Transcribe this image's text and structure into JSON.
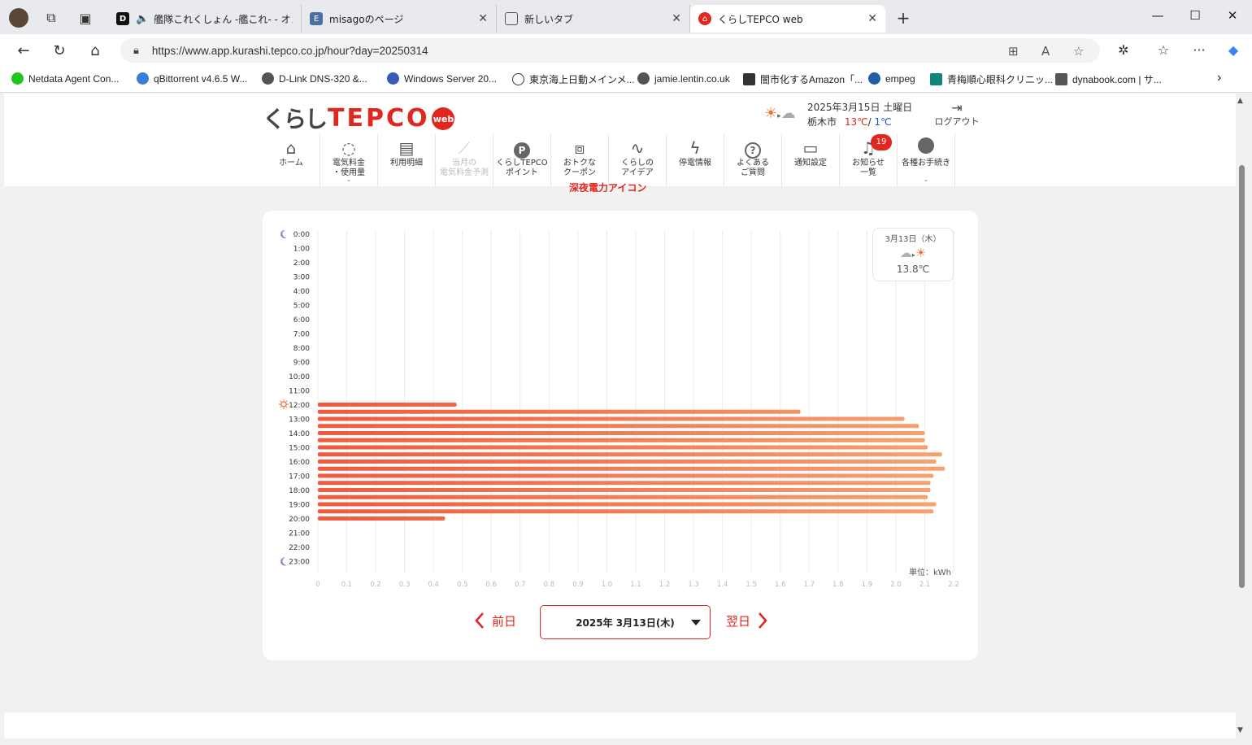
{
  "browser": {
    "tabs": [
      {
        "title": "艦隊これくしょん -艦これ- - オン",
        "favicon_color": "#111111",
        "favicon_text": "D",
        "active": false
      },
      {
        "title": "misagoのページ",
        "favicon_color": "#4a6fa5",
        "favicon_text": "E",
        "active": false
      },
      {
        "title": "新しいタブ",
        "favicon_color": "#ffffff",
        "favicon_text": "",
        "active": false
      },
      {
        "title": "くらしTEPCO web",
        "favicon_color": "#e0261d",
        "favicon_text": "⌂",
        "active": true
      }
    ],
    "url": "https://www.app.kurashi.tepco.co.jp/hour?day=20250314",
    "bookmarks": [
      {
        "label": "Netdata Agent Con...",
        "color": "#1ec61e"
      },
      {
        "label": "qBittorrent v4.6.5 W...",
        "color": "#3b7dd8"
      },
      {
        "label": "D-Link DNS-320 &...",
        "color": "#555555"
      },
      {
        "label": "Windows Server 20...",
        "color": "#3a58b8"
      },
      {
        "label": "東京海上日動メインメ...",
        "color": "#777777"
      },
      {
        "label": "jamie.lentin.co.uk",
        "color": "#555555"
      },
      {
        "label": "闇市化するAmazon「...",
        "color": "#333333"
      },
      {
        "label": "empeg",
        "color": "#1f5fa8"
      },
      {
        "label": "青梅順心眼科クリニッ...",
        "color": "#10857a"
      },
      {
        "label": "dynabook.com | サ...",
        "color": "#555555"
      }
    ]
  },
  "header": {
    "logo_kurashi": "くらし",
    "logo_text": "TEPCO",
    "logo_badge": "web",
    "weather_date": "2025年3月15日 土曜日",
    "city": "栃木市",
    "temp_high": "13℃",
    "temp_sep": "/",
    "temp_low": "1℃",
    "logout": "ログアウト"
  },
  "nav": [
    {
      "line1": "ホーム",
      "line2": "",
      "icon": "home-icon",
      "glyph": "⌂",
      "disabled": false,
      "chevron": false
    },
    {
      "line1": "電気料金",
      "line2": "・使用量",
      "icon": "lightbulb-icon",
      "glyph": "◌",
      "disabled": false,
      "chevron": true
    },
    {
      "line1": "利用明細",
      "line2": "",
      "icon": "document-icon",
      "glyph": "▤",
      "disabled": false,
      "chevron": false
    },
    {
      "line1": "当月の",
      "line2": "電気料金予測",
      "icon": "trend-icon",
      "glyph": "⟋",
      "disabled": true,
      "chevron": false
    },
    {
      "line1": "くらしTEPCO",
      "line2": "ポイント",
      "icon": "point-icon",
      "glyph": "P",
      "disabled": false,
      "chevron": false
    },
    {
      "line1": "おトクな",
      "line2": "クーポン",
      "icon": "gift-icon",
      "glyph": "⧈",
      "disabled": false,
      "chevron": false
    },
    {
      "line1": "くらしの",
      "line2": "アイデア",
      "icon": "idea-icon",
      "glyph": "∿",
      "disabled": false,
      "chevron": false
    },
    {
      "line1": "停電情報",
      "line2": "",
      "icon": "lightning-icon",
      "glyph": "ϟ",
      "disabled": false,
      "chevron": false
    },
    {
      "line1": "よくある",
      "line2": "ご質問",
      "icon": "question-icon",
      "glyph": "?",
      "disabled": false,
      "chevron": false
    },
    {
      "line1": "通知設定",
      "line2": "",
      "icon": "chat-icon",
      "glyph": "▭",
      "disabled": false,
      "chevron": false
    },
    {
      "line1": "お知らせ",
      "line2": "一覧",
      "icon": "bell-icon",
      "glyph": "♫",
      "disabled": false,
      "chevron": false,
      "badge": "19"
    },
    {
      "line1": "各種お手続き",
      "line2": "",
      "icon": "user-icon",
      "glyph": "●",
      "disabled": false,
      "chevron": true
    }
  ],
  "partial_heading": "深夜電力アイコン",
  "weather_box": {
    "date": "3月13日（木）",
    "temp": "13.8℃"
  },
  "unit_label": "単位：kWh",
  "day_nav": {
    "prev": "前日",
    "selected_date": "2025年 3月13日(木)",
    "next": "翌日"
  },
  "chart_data": {
    "type": "bar",
    "orientation": "horizontal",
    "categories": [
      "0:00",
      "1:00",
      "2:00",
      "3:00",
      "4:00",
      "5:00",
      "6:00",
      "7:00",
      "8:00",
      "9:00",
      "10:00",
      "11:00",
      "12:00",
      "13:00",
      "14:00",
      "15:00",
      "16:00",
      "17:00",
      "18:00",
      "19:00",
      "20:00",
      "21:00",
      "22:00",
      "23:00"
    ],
    "x_ticks": [
      "0",
      "0.1",
      "0.2",
      "0.3",
      "0.4",
      "0.5",
      "0.6",
      "0.7",
      "0.8",
      "0.9",
      "1.0",
      "1.1",
      "1.2",
      "1.3",
      "1.4",
      "1.5",
      "1.6",
      "1.7",
      "1.8",
      "1.9",
      "2.0",
      "2.1",
      "2.2"
    ],
    "xlim": [
      0,
      2.2
    ],
    "grid": true,
    "legend": "none",
    "colors": {
      "bar_start": "#ef5a3c",
      "bar_end": "#f6a470",
      "moon": "#8b7fe0",
      "sun": "#f07030"
    },
    "half_hour_bars": [
      {
        "hour": 12,
        "half": 0,
        "value": 0.48
      },
      {
        "hour": 12,
        "half": 1,
        "value": 1.67
      },
      {
        "hour": 13,
        "half": 0,
        "value": 2.03
      },
      {
        "hour": 13,
        "half": 1,
        "value": 2.08
      },
      {
        "hour": 14,
        "half": 0,
        "value": 2.1
      },
      {
        "hour": 14,
        "half": 1,
        "value": 2.1
      },
      {
        "hour": 15,
        "half": 0,
        "value": 2.11
      },
      {
        "hour": 15,
        "half": 1,
        "value": 2.16
      },
      {
        "hour": 16,
        "half": 0,
        "value": 2.14
      },
      {
        "hour": 16,
        "half": 1,
        "value": 2.17
      },
      {
        "hour": 17,
        "half": 0,
        "value": 2.13
      },
      {
        "hour": 17,
        "half": 1,
        "value": 2.12
      },
      {
        "hour": 18,
        "half": 0,
        "value": 2.12
      },
      {
        "hour": 18,
        "half": 1,
        "value": 2.11
      },
      {
        "hour": 19,
        "half": 0,
        "value": 2.14
      },
      {
        "hour": 19,
        "half": 1,
        "value": 2.13
      },
      {
        "hour": 20,
        "half": 0,
        "value": 0.44
      }
    ],
    "markers": [
      {
        "hour": 0,
        "icon": "moon-icon"
      },
      {
        "hour": 12,
        "icon": "sun-icon"
      },
      {
        "hour": 23,
        "icon": "moon-icon"
      }
    ]
  }
}
